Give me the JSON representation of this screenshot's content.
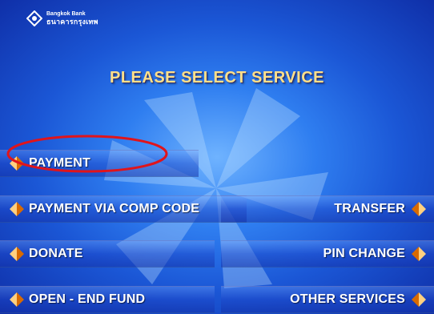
{
  "bank": {
    "name_en": "Bangkok Bank",
    "name_th": "ธนาคารกรุงเทพ",
    "logo_icon": "bangkok-bank-logo-icon"
  },
  "title": "PLEASE SELECT SERVICE",
  "buttons": {
    "payment": "PAYMENT",
    "payment_via_comp_code": "PAYMENT VIA COMP CODE",
    "transfer": "TRANSFER",
    "donate": "DONATE",
    "pin_change": "PIN CHANGE",
    "open_end_fund": "OPEN - END FUND",
    "other_services": "OTHER SERVICES"
  },
  "arrow_icon": "orange-diamond-arrow-icon",
  "annotation": {
    "type": "red-circle-highlight",
    "target": "payment",
    "color": "#e0141b"
  },
  "colors": {
    "background": "#1b57d6",
    "title": "#ffe08a",
    "label": "#ffffff",
    "arrow_light": "#ffd080",
    "arrow_dark": "#d86a00"
  }
}
